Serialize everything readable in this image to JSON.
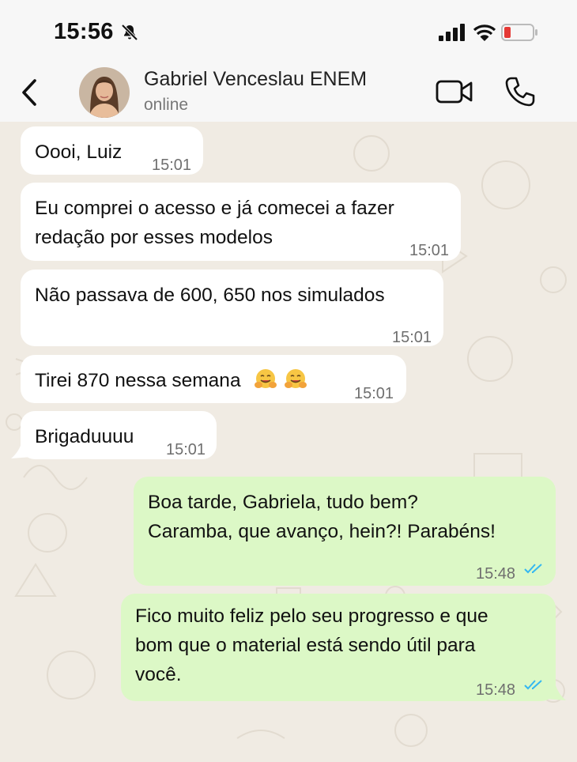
{
  "status_bar": {
    "time": "15:56"
  },
  "header": {
    "contact_name": "Gabriel Venceslau ENEM",
    "status": "online"
  },
  "messages": [
    {
      "direction": "in",
      "text": "Oooi, Luiz",
      "time": "15:01"
    },
    {
      "direction": "in",
      "text": "Eu comprei o acesso e já comecei a fazer\nredação por esses modelos",
      "time": "15:01"
    },
    {
      "direction": "in",
      "text": "Não passava de 600, 650 nos simulados",
      "time": "15:01"
    },
    {
      "direction": "in",
      "text": "Tirei 870 nessa semana",
      "emoji": [
        "hugging-face",
        "hugging-face"
      ],
      "time": "15:01"
    },
    {
      "direction": "in",
      "text": "Brigaduuuu",
      "time": "15:01"
    },
    {
      "direction": "out",
      "text": "Boa tarde, Gabriela, tudo bem?\nCaramba, que avanço, hein?! Parabéns!",
      "time": "15:48",
      "read": true
    },
    {
      "direction": "out",
      "text": "Fico muito feliz pelo seu progresso e que\nbom que o material está sendo útil para\nvocê.",
      "time": "15:48",
      "read": true
    }
  ],
  "colors": {
    "chat_background": "#f0ebe3",
    "incoming_bubble": "#ffffff",
    "outgoing_bubble": "#dcf8c6",
    "read_ticks": "#34b7f1"
  }
}
